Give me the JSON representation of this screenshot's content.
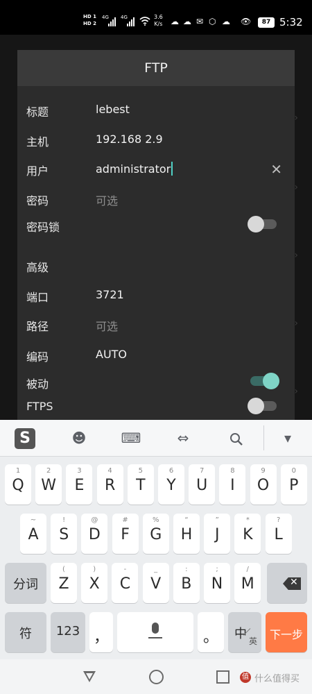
{
  "status_bar": {
    "hd_top": "HD 1",
    "hd_bottom": "HD 2",
    "net1": "4G",
    "net2": "4G",
    "speed_value": "3.6",
    "speed_unit": "K/s",
    "battery": "87",
    "time": "5:32"
  },
  "dialog": {
    "title": "FTP",
    "fields": {
      "title_label": "标题",
      "title_value": "lebest",
      "host_label": "主机",
      "host_value": "192.168 2.9",
      "user_label": "用户",
      "user_value": "administrator",
      "password_label": "密码",
      "password_placeholder": "可选",
      "password_lock_label": "密码锁",
      "password_lock_on": false
    },
    "advanced": {
      "section_label": "高级",
      "port_label": "端口",
      "port_value": "3721",
      "path_label": "路径",
      "path_placeholder": "可选",
      "encoding_label": "编码",
      "encoding_value": "AUTO",
      "passive_label": "被动",
      "passive_on": true,
      "ftps_label": "FTPS",
      "ftps_on": false
    }
  },
  "keyboard": {
    "toolbar_icons": [
      "sogou-logo-icon",
      "emoji-icon",
      "keyboard-icon",
      "cursor-move-icon",
      "search-icon",
      "collapse-icon"
    ],
    "logo_text": "S",
    "row1": [
      {
        "main": "Q",
        "sub": "1"
      },
      {
        "main": "W",
        "sub": "2"
      },
      {
        "main": "E",
        "sub": "3"
      },
      {
        "main": "R",
        "sub": "4"
      },
      {
        "main": "T",
        "sub": "5"
      },
      {
        "main": "Y",
        "sub": "6"
      },
      {
        "main": "U",
        "sub": "7"
      },
      {
        "main": "I",
        "sub": "8"
      },
      {
        "main": "O",
        "sub": "9"
      },
      {
        "main": "P",
        "sub": "0"
      }
    ],
    "row2": [
      {
        "main": "A",
        "sub": "~"
      },
      {
        "main": "S",
        "sub": "!"
      },
      {
        "main": "D",
        "sub": "@"
      },
      {
        "main": "F",
        "sub": "#"
      },
      {
        "main": "G",
        "sub": "%"
      },
      {
        "main": "H",
        "sub": "“"
      },
      {
        "main": "J",
        "sub": "”"
      },
      {
        "main": "K",
        "sub": "*"
      },
      {
        "main": "L",
        "sub": "?"
      }
    ],
    "row3_left": "分词",
    "row3": [
      {
        "main": "Z",
        "sub": "("
      },
      {
        "main": "X",
        "sub": ")"
      },
      {
        "main": "C",
        "sub": "-"
      },
      {
        "main": "V",
        "sub": "_"
      },
      {
        "main": "B",
        "sub": ":"
      },
      {
        "main": "N",
        "sub": ";"
      },
      {
        "main": "M",
        "sub": "/"
      }
    ],
    "symbol_key": "符",
    "num_key": "123",
    "comma_key": "，",
    "period_key": "。",
    "lang_key_main": "中",
    "lang_key_sub": "英",
    "next_key": "下一步",
    "backspace_glyph": "✕"
  },
  "nav": {
    "watermark": "什么值得买",
    "watermark_logo": "值"
  }
}
